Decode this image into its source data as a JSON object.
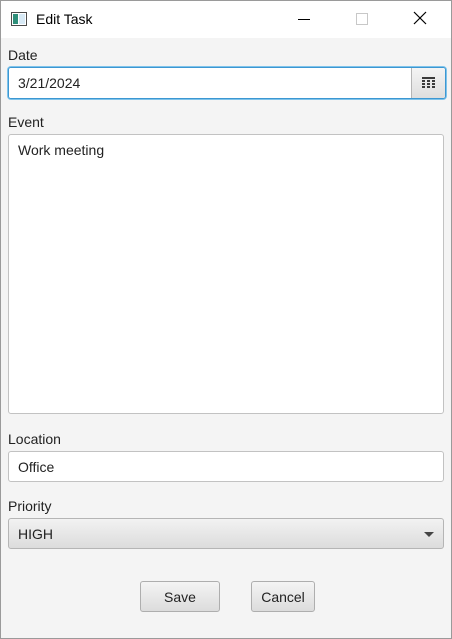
{
  "window": {
    "title": "Edit Task"
  },
  "form": {
    "date_label": "Date",
    "date_value": "3/21/2024",
    "event_label": "Event",
    "event_value": "Work meeting",
    "location_label": "Location",
    "location_value": "Office",
    "priority_label": "Priority",
    "priority_value": "HIGH"
  },
  "buttons": {
    "save": "Save",
    "cancel": "Cancel"
  },
  "icons": {
    "app": "app-window-icon",
    "calendar": "calendar-icon",
    "minimize": "minimize-icon",
    "maximize": "maximize-icon",
    "close": "close-icon",
    "dropdown": "chevron-down-icon"
  },
  "colors": {
    "focus_border": "#3c97d2",
    "background": "#f4f4f4"
  }
}
